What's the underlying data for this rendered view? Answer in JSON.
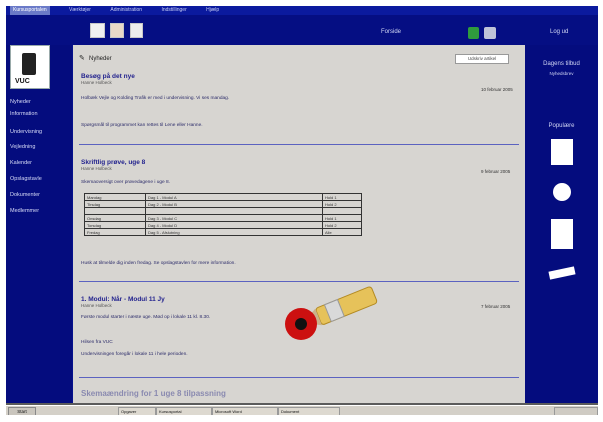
{
  "menubar": {
    "items": [
      "Kursusportalen",
      "Værktøjer",
      "Administration",
      "Indstillinger",
      "Hjælp"
    ]
  },
  "topbar": {
    "forside_label": "Forside",
    "logud_label": "Log ud"
  },
  "left_nav": {
    "logo_text": "VUC",
    "items": [
      "Nyheder",
      "Information",
      "Undervisning",
      "Vejledning",
      "Kalender",
      "Opslagstavle",
      "Dokumenter",
      "Medlemmer"
    ]
  },
  "content": {
    "breadcrumb": "Nyheder",
    "print_button": "Udskriv artikel",
    "posts": [
      {
        "title": "Besøg på det nye",
        "author": "Hanne Holbeck",
        "date": "10 februar 2005",
        "body1": "Holbæk Vejle og Kolding Trafik er med i undervisning. Vi ses mandag.",
        "body2": "Spørgsmål til programmet kan rettes til Lene eller Hanne."
      },
      {
        "title": "Skriftlig prøve, uge 8",
        "author": "Hanne Holbeck",
        "date": "9 februar 2005",
        "intro": "Skemaoversigt over prøvedagene i uge 8.",
        "table": [
          [
            "Mandag",
            "Dag 1 - Modul A",
            "Hold 1"
          ],
          [
            "Tirsdag",
            "Dag 2 - Modul B",
            "Hold 2"
          ],
          [
            "",
            "",
            ""
          ],
          [
            "Onsdag",
            "Dag 3 - Modul C",
            "Hold 1"
          ],
          [
            "Torsdag",
            "Dag 4 - Modul D",
            "Hold 2"
          ],
          [
            "Fredag",
            "Dag 5 - Afslutning",
            "Alle"
          ]
        ],
        "footer": "Husk at tilmelde dig inden fredag. Se opslagstavlen for mere information."
      },
      {
        "title": "1. Modul: Når - Modul 11 Jy",
        "author": "Hanne Holbeck",
        "date": "7 februar 2005",
        "body1": "Første modul starter i næste uge. Mød op i lokale 11 kl. 8.30.",
        "body2": "Hilsen fra VUC",
        "body3": "Undervisningen foregår i lokale 11 i hele perioden."
      }
    ],
    "next_post_title": "Skemaændring for 1 uge 8 tilpassning"
  },
  "right_panel": {
    "title1": "Dagens tilbud",
    "subtitle": "Nyhedsbrev",
    "title2": "Populære"
  },
  "taskbar": {
    "start_label": "Start",
    "tasks": [
      "Opgaver",
      "Kursusportal",
      "Microsoft Word",
      "Dokument"
    ]
  },
  "colors": {
    "frame": "#06118c",
    "content_bg": "#d7d5d1",
    "title": "#23238e"
  }
}
